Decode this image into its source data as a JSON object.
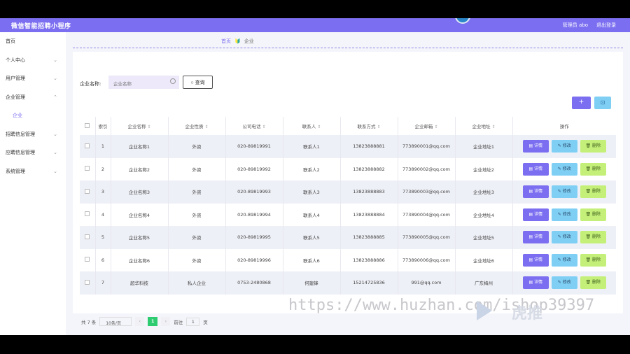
{
  "app": {
    "title": "微信智能招聘小程序",
    "admin": "管理员 abo",
    "logout": "退出登录"
  },
  "sidebar": {
    "items": [
      {
        "label": "首页",
        "arrow": ""
      },
      {
        "label": "个人中心",
        "arrow": "⌄"
      },
      {
        "label": "用户管理",
        "arrow": "⌄"
      },
      {
        "label": "企业管理",
        "arrow": "⌃"
      },
      {
        "label": "企业",
        "arrow": ""
      },
      {
        "label": "招聘信息管理",
        "arrow": "⌄"
      },
      {
        "label": "应聘信息管理",
        "arrow": "⌄"
      },
      {
        "label": "系统管理",
        "arrow": "⌄"
      }
    ]
  },
  "breadcrumb": {
    "home": "首页",
    "current": "企业"
  },
  "search": {
    "label": "企业名称:",
    "placeholder": "企业名称",
    "query_btn": "查询"
  },
  "toolbar": {
    "add": "+",
    "delete": "⊡"
  },
  "table": {
    "headers": [
      "索引",
      "企业名称",
      "企业性质",
      "公司电话",
      "联系人",
      "联系方式",
      "企业邮箱",
      "企业地址",
      "操作"
    ],
    "rows": [
      {
        "idx": "1",
        "name": "企业名称1",
        "type": "外资",
        "phone": "020-89819991",
        "contact": "联系人1",
        "mobile": "13823888881",
        "email": "773890001@qq.com",
        "addr": "企业地址1"
      },
      {
        "idx": "2",
        "name": "企业名称2",
        "type": "外资",
        "phone": "020-89819992",
        "contact": "联系人2",
        "mobile": "13823888882",
        "email": "773890002@qq.com",
        "addr": "企业地址2"
      },
      {
        "idx": "3",
        "name": "企业名称3",
        "type": "外资",
        "phone": "020-89819993",
        "contact": "联系人3",
        "mobile": "13823888883",
        "email": "773890003@qq.com",
        "addr": "企业地址3"
      },
      {
        "idx": "4",
        "name": "企业名称4",
        "type": "外资",
        "phone": "020-89819994",
        "contact": "联系人4",
        "mobile": "13823888884",
        "email": "773890004@qq.com",
        "addr": "企业地址4"
      },
      {
        "idx": "5",
        "name": "企业名称5",
        "type": "外资",
        "phone": "020-89819995",
        "contact": "联系人5",
        "mobile": "13823888885",
        "email": "773890005@qq.com",
        "addr": "企业地址5"
      },
      {
        "idx": "6",
        "name": "企业名称6",
        "type": "外资",
        "phone": "020-89819996",
        "contact": "联系人6",
        "mobile": "13823888886",
        "email": "773890006@qq.com",
        "addr": "企业地址6"
      },
      {
        "idx": "7",
        "name": "超华科技",
        "type": "私人企业",
        "phone": "0753-2480868",
        "contact": "何建锋",
        "mobile": "15214725836",
        "email": "991@qq.com",
        "addr": "广东梅州"
      }
    ],
    "ops": {
      "detail": "详情",
      "edit": "修改",
      "delete": "删除"
    }
  },
  "pager": {
    "total": "共 7 条",
    "size": "10条/页",
    "prev": "‹",
    "current": "1",
    "next": "›",
    "goto": "前往",
    "goto_page": "1",
    "page_unit": "页"
  },
  "watermark": {
    "url": "https://www.huzhan.com/ishop39397",
    "logo": "虎推"
  }
}
